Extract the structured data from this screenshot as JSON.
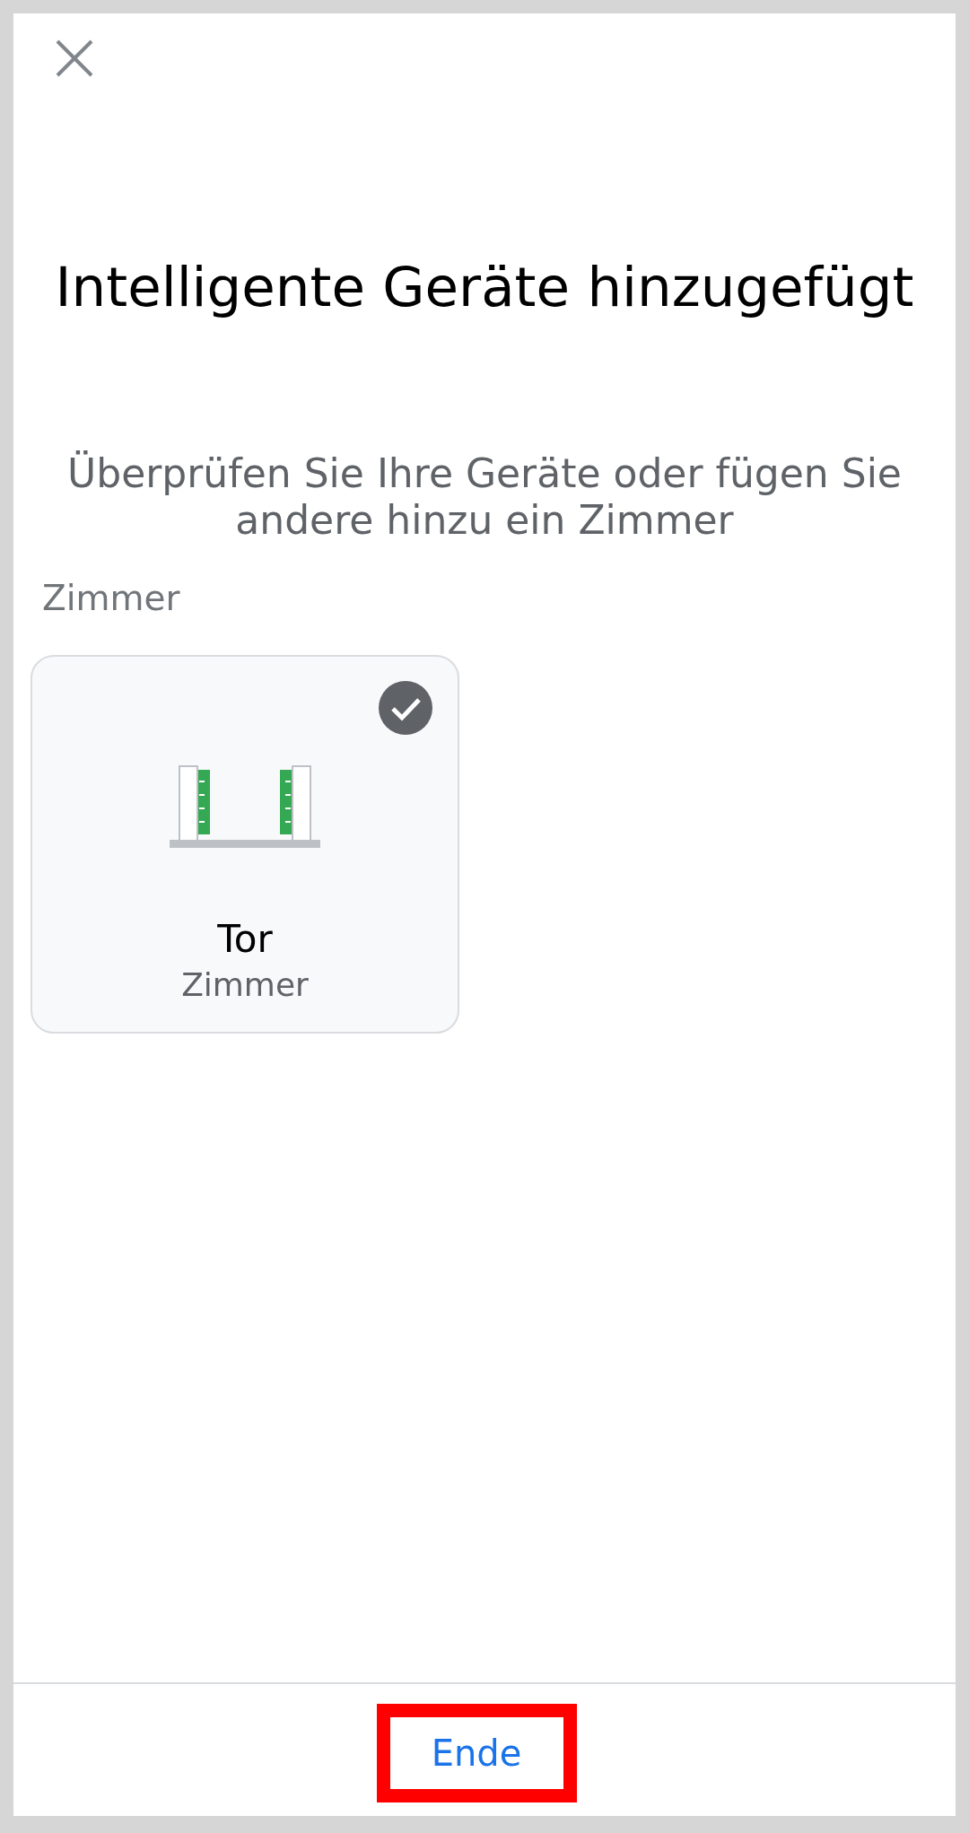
{
  "title": "Intelligente Geräte hinzugefügt",
  "subtitle": "Überprüfen Sie Ihre Geräte oder fügen Sie andere hinzu ein Zimmer",
  "section": {
    "label": "Zimmer",
    "devices": [
      {
        "kind": "gate",
        "name": "Tor",
        "room": "Zimmer",
        "selected": true
      }
    ]
  },
  "footer": {
    "button": {
      "label": "Ende",
      "highlighted": true
    }
  }
}
